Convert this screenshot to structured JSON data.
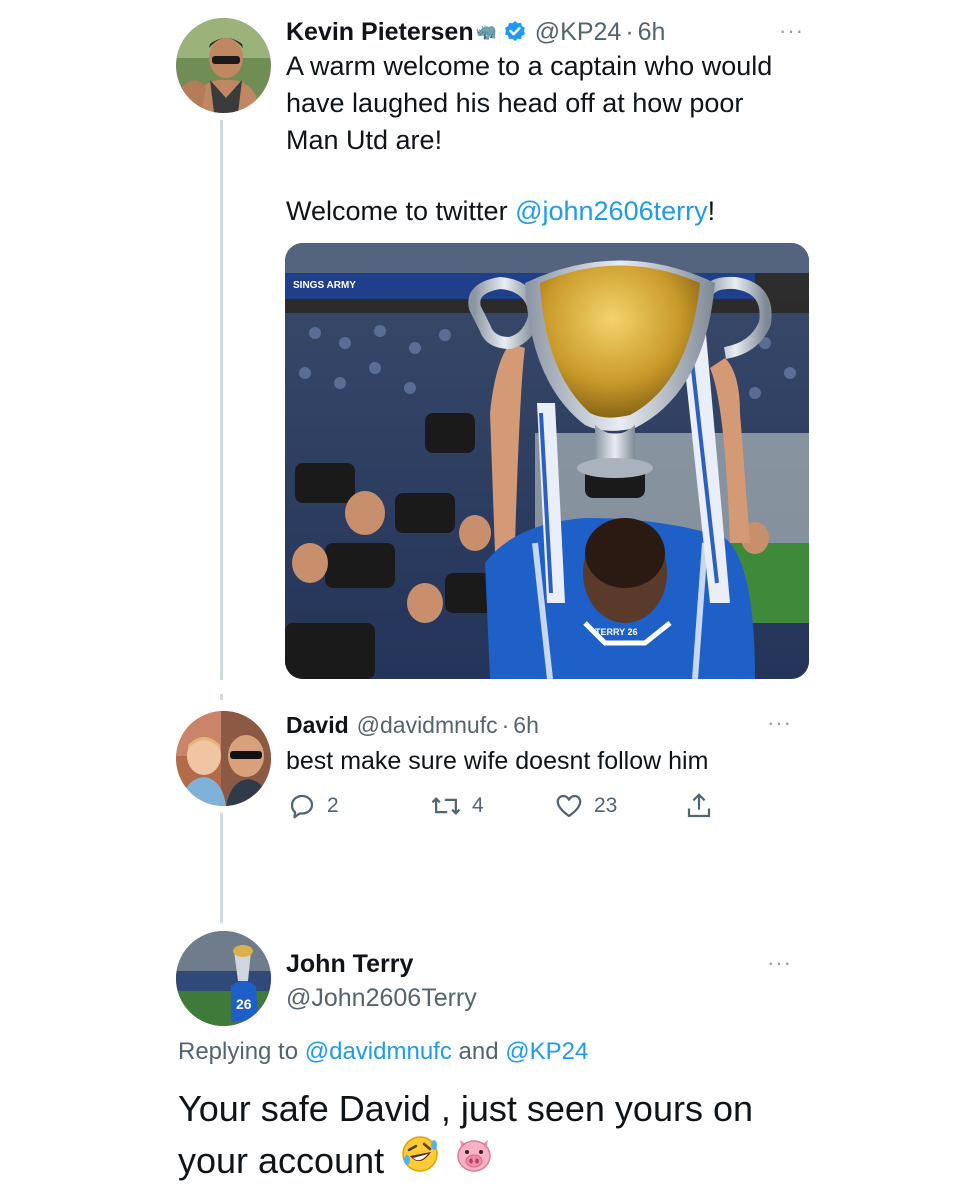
{
  "tweet1": {
    "author_name": "Kevin Pietersen",
    "author_emoji": "🦏",
    "verified": true,
    "handle": "@KP24",
    "time": "6h",
    "text_line1": "A warm welcome to a captain who would",
    "text_line2": "have laughed his head off at how poor",
    "text_line3": "Man Utd are!",
    "welcome_prefix": "Welcome to twitter ",
    "welcome_mention": "@john2606terry",
    "welcome_suffix": "!",
    "photo_banner_text": "SINGS ARMY",
    "photo_jersey_text": "TERRY 26"
  },
  "tweet2": {
    "author_name": "David",
    "handle": "@davidmnufc",
    "time": "6h",
    "text": "best make sure wife doesnt follow him",
    "replies": "2",
    "retweets": "4",
    "likes": "23"
  },
  "tweet3": {
    "author_name": "John Terry",
    "handle": "@John2606Terry",
    "avatar_text": "26",
    "replying_prefix": "Replying to ",
    "replying_user1": "@davidmnufc",
    "replying_and": " and ",
    "replying_user2": "@KP24",
    "text_line1": "Your safe David , just seen yours on",
    "text_line2": "your account"
  },
  "colors": {
    "link": "#1d9bf0",
    "secondary_text": "#536471",
    "thread_line": "#cfd9de",
    "verified_badge": "#1d9bf0"
  },
  "icons": [
    "reply-icon",
    "retweet-icon",
    "like-icon",
    "share-icon",
    "more-icon",
    "verified-icon",
    "rofl-emoji",
    "pig-emoji"
  ]
}
